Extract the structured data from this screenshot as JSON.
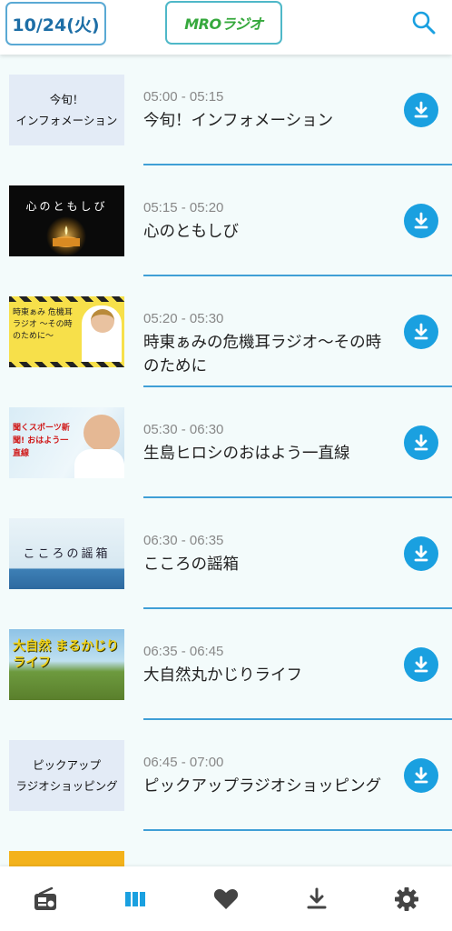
{
  "header": {
    "date": "10/24(火)",
    "logo": "MROラジオ",
    "search_icon": "search-icon"
  },
  "programs": [
    {
      "time": "05:00 - 05:15",
      "title": "今旬！インフォメーション",
      "thumb_text": "今旬！\nインフォメーション"
    },
    {
      "time": "05:15 - 05:20",
      "title": "心のともしび",
      "thumb_text": "心のともしび"
    },
    {
      "time": "05:20 - 05:30",
      "title": "時東ぁみの危機耳ラジオ〜その時のために",
      "thumb_text": "時東ぁみ 危機耳 ラジオ 〜その時のために〜"
    },
    {
      "time": "05:30 - 06:30",
      "title": "生島ヒロシのおはよう一直線",
      "thumb_text": "聞くスポーツ新聞! おはよう一直線"
    },
    {
      "time": "06:30 - 06:35",
      "title": "こころの謡箱",
      "thumb_text": "こころの謡箱"
    },
    {
      "time": "06:35 - 06:45",
      "title": "大自然丸かじりライフ",
      "thumb_text": "大自然 まるかじりライフ"
    },
    {
      "time": "06:45 - 07:00",
      "title": "ピックアップラジオショッピング",
      "thumb_text": "ピックアップ\nラジオショッピング"
    }
  ],
  "bottom_nav": [
    "radio-icon",
    "program-list-icon",
    "favorite-heart-icon",
    "download-icon",
    "settings-gear-icon"
  ],
  "colors": {
    "accent": "#1aa0e0",
    "separator": "#3f9fd6",
    "active_nav": "#1aa0e0",
    "inactive_nav": "#444444",
    "logo_green": "#35a83c"
  }
}
